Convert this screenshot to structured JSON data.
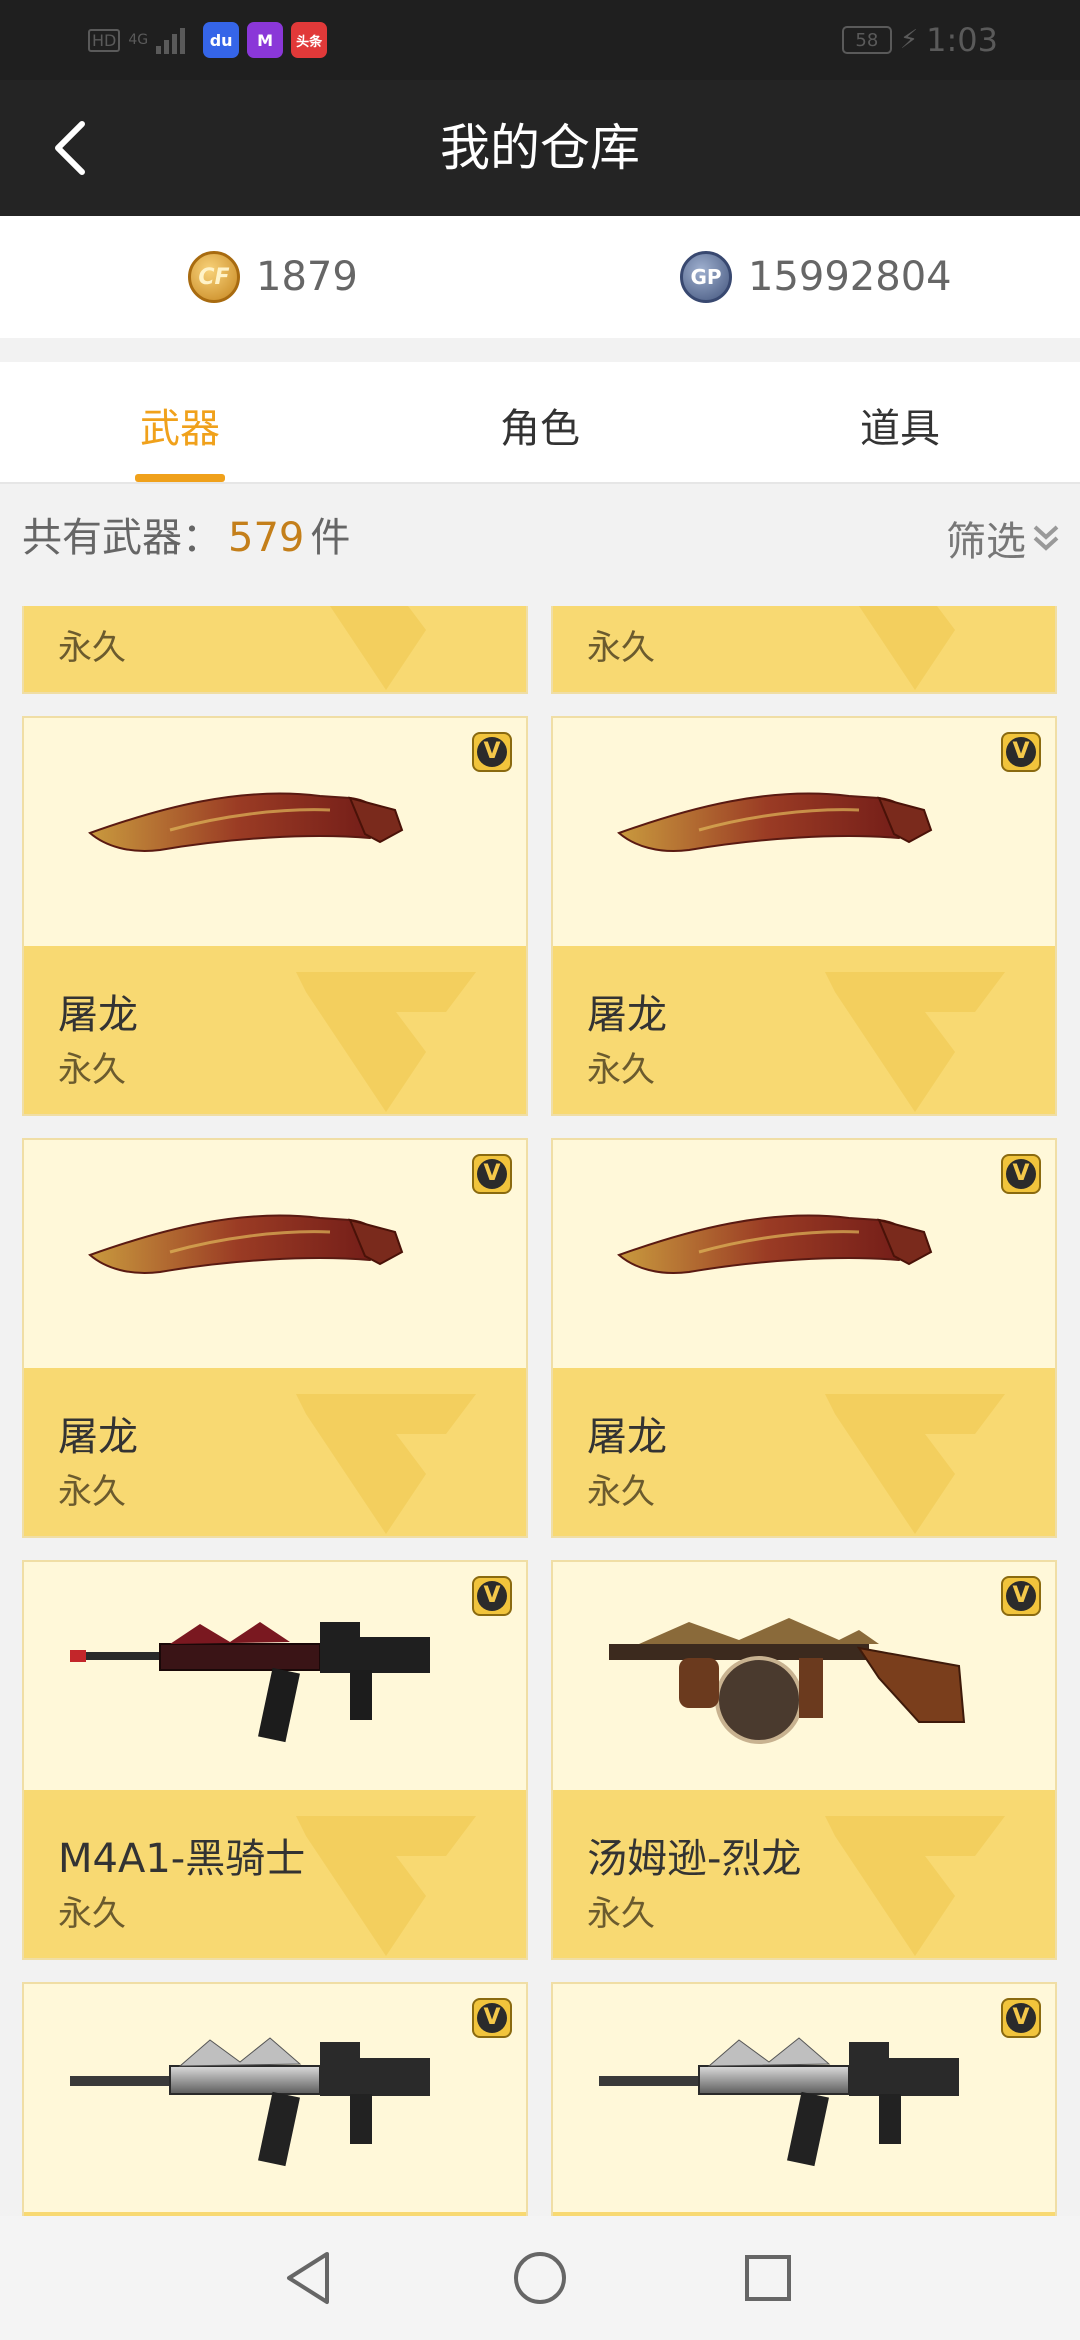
{
  "status_bar": {
    "network": "HD",
    "network_gen": "4G",
    "battery": "58",
    "time": "1:03",
    "apps": [
      {
        "name": "baidu-app-icon",
        "label": "du",
        "color": "#3565e8"
      },
      {
        "name": "meitu-app-icon",
        "label": "M",
        "color": "#8a37d8"
      },
      {
        "name": "toutiao-app-icon",
        "label": "头条",
        "color": "#e13939"
      }
    ]
  },
  "header": {
    "title": "我的仓库"
  },
  "currency": {
    "cf_points": "1879",
    "gp": "15992804",
    "cf_icon_label": "CF",
    "gp_icon_label": "GP"
  },
  "tabs": [
    {
      "label": "武器",
      "active": true
    },
    {
      "label": "角色",
      "active": false
    },
    {
      "label": "道具",
      "active": false
    }
  ],
  "summary": {
    "prefix": "共有武器：",
    "count": "579",
    "suffix": "件",
    "filter_label": "筛选"
  },
  "items": [
    {
      "name": "",
      "duration": "永久",
      "weapon": "none"
    },
    {
      "name": "",
      "duration": "永久",
      "weapon": "none"
    },
    {
      "name": "屠龙",
      "duration": "永久",
      "weapon": "knife"
    },
    {
      "name": "屠龙",
      "duration": "永久",
      "weapon": "knife"
    },
    {
      "name": "屠龙",
      "duration": "永久",
      "weapon": "knife"
    },
    {
      "name": "屠龙",
      "duration": "永久",
      "weapon": "knife"
    },
    {
      "name": "M4A1-黑骑士",
      "duration": "永久",
      "weapon": "m4a1-dark"
    },
    {
      "name": "汤姆逊-烈龙",
      "duration": "永久",
      "weapon": "thompson"
    },
    {
      "name": "",
      "duration": "",
      "weapon": "m4a1-silver"
    },
    {
      "name": "",
      "duration": "",
      "weapon": "m4a1-silver"
    }
  ],
  "vip_badge": "V",
  "colors": {
    "accent": "#f0a11b",
    "header_bg": "#242424",
    "card_bg": "#fff8d9",
    "card_info_bg": "#f8d972"
  }
}
